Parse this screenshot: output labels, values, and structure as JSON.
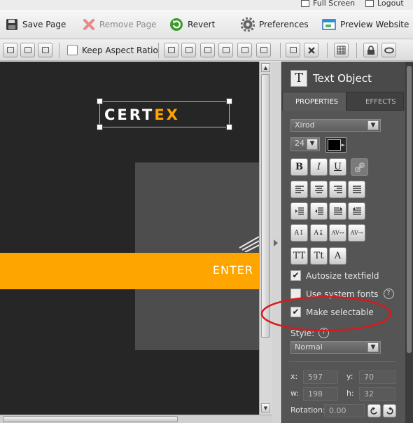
{
  "topbar": {
    "full_screen": "Full Screen",
    "logout": "Logout"
  },
  "menu": {
    "save": "Save Page",
    "remove": "Remove Page",
    "revert": "Revert",
    "preferences": "Preferences",
    "preview": "Preview Website"
  },
  "toolbar": {
    "keep_aspect": "Keep Aspect Ratio"
  },
  "canvas": {
    "logo_left": "CERT",
    "logo_right": "EX",
    "banner": "ENTER"
  },
  "panel": {
    "title": "Text Object",
    "tabs": [
      "PROPERTIES",
      "EFFECTS"
    ],
    "font": "Xirod",
    "font_size": "24",
    "bold": "B",
    "italic": "I",
    "underline": "U",
    "case_upper": "TT",
    "case_title": "Tt",
    "text_icon": "A",
    "autosize": "Autosize textfield",
    "system_fonts": "Use system fonts",
    "selectable": "Make selectable",
    "help": "?",
    "style_label": "Style:",
    "style_value": "Normal",
    "x_label": "x:",
    "x": "597",
    "y_label": "y:",
    "y": "70",
    "w_label": "w:",
    "w": "198",
    "h_label": "h:",
    "h": "32",
    "rotation_label": "Rotation:",
    "rotation": "0.00"
  },
  "colors": {
    "accent": "#ffa500",
    "highlight_ellipse": "#d9191c",
    "canvas": "#262626",
    "panel": "#4a4a4a"
  }
}
